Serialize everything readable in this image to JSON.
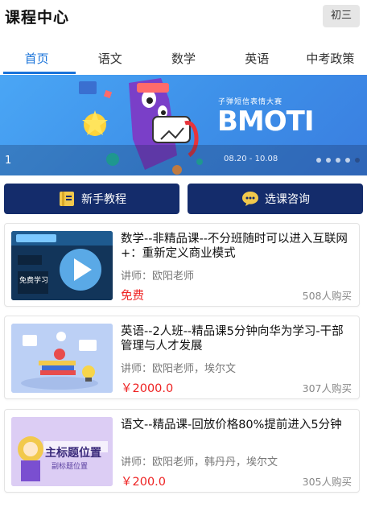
{
  "header": {
    "title": "课程中心",
    "grade_button": "初三"
  },
  "tabs": [
    {
      "label": "首页",
      "active": true
    },
    {
      "label": "语文",
      "active": false
    },
    {
      "label": "数学",
      "active": false
    },
    {
      "label": "英语",
      "active": false
    },
    {
      "label": "中考政策",
      "active": false
    }
  ],
  "banner": {
    "index": "1",
    "subtitle": "子弹短信表情大赛",
    "big_text": "BMOTI",
    "date": "08.20 - 10.08",
    "dot_count": 5,
    "active_dot": 5
  },
  "quick_actions": [
    {
      "label": "新手教程",
      "icon": "book-icon"
    },
    {
      "label": "选课咨询",
      "icon": "chat-bubble-icon"
    }
  ],
  "courses": [
    {
      "title": "数学--非精品课--不分班随时可以进入互联网+：重新定义商业模式",
      "teacher": "讲师：欧阳老师",
      "price": "免费",
      "count": "508人购买",
      "thumb_label": "免费学习"
    },
    {
      "title": "英语--2人班--精品课5分钟向华为学习-干部管理与人才发展",
      "teacher": "讲师：欧阳老师，埃尔文",
      "price": "￥2000.0",
      "count": "307人购买"
    },
    {
      "title": "语文--精品课-回放价格80%提前进入5分钟",
      "teacher": "讲师：欧阳老师，韩丹丹，埃尔文",
      "price": "￥200.0",
      "count": "305人购买",
      "thumb_label": "主标题位置",
      "thumb_sub": "副标题位置"
    }
  ],
  "colors": {
    "accent": "#1a73d9",
    "navy": "#142c6b",
    "price": "#ee2222"
  }
}
